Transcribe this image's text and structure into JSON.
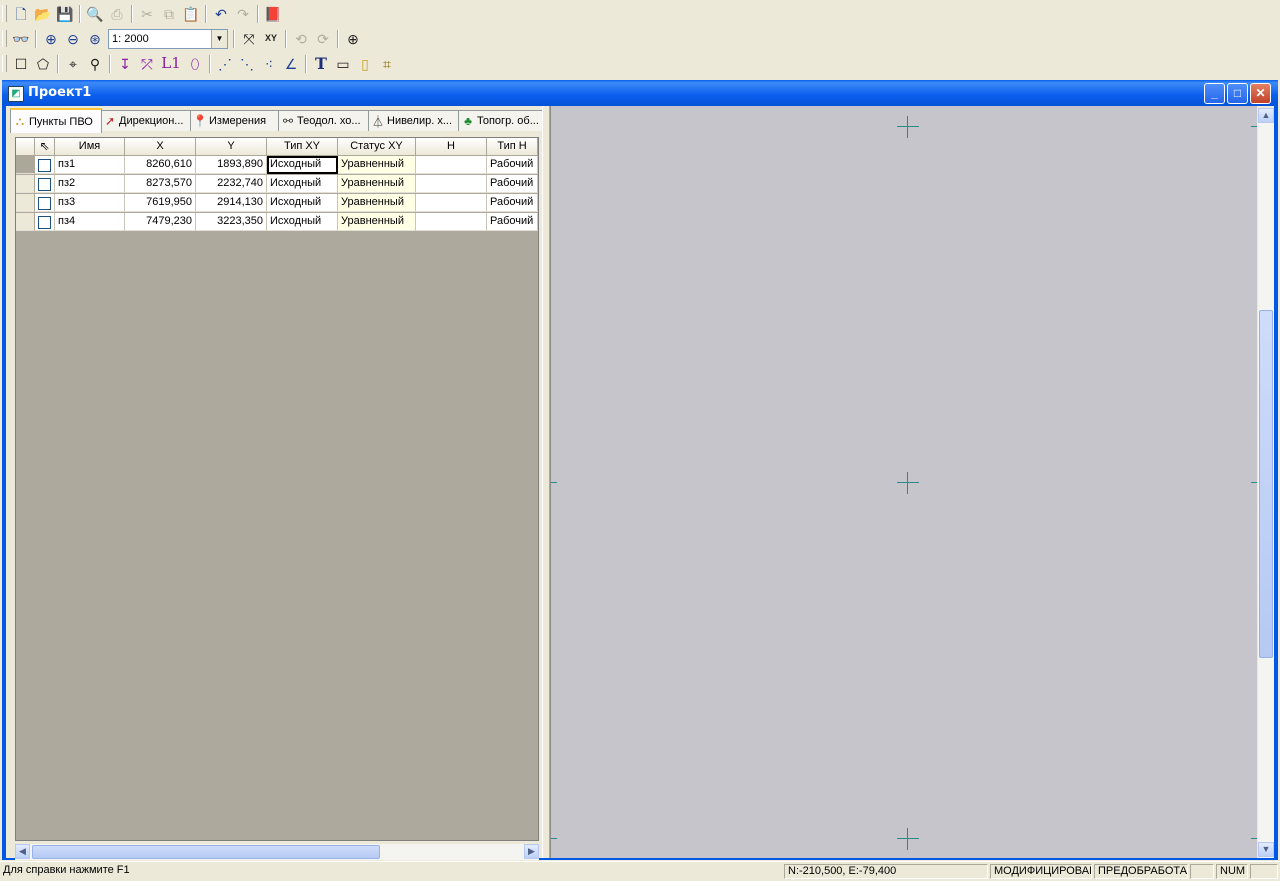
{
  "toolbar": {
    "scale_value": "1: 2000",
    "row1": [
      "new-file",
      "open-folder",
      "save",
      "print-preview",
      "print",
      "cut",
      "copy",
      "paste",
      "undo",
      "redo",
      "help-book"
    ],
    "row2": [
      "glasses",
      "zoom-in",
      "zoom-out",
      "zoom-fit",
      "scale-combo",
      "fit-extent",
      "xy-coords",
      "pan-prev",
      "pan-next",
      "target"
    ],
    "row3_text_tool_label": "T",
    "row3_lines_label": "L1"
  },
  "window": {
    "title": "Проект1"
  },
  "tabs": [
    {
      "label": "Пункты ПВО",
      "icon": "survey-points-icon",
      "active": true
    },
    {
      "label": "Дирекцион...",
      "icon": "direction-icon",
      "active": false
    },
    {
      "label": "Измерения",
      "icon": "measure-icon",
      "active": false
    },
    {
      "label": "Теодол. хо...",
      "icon": "theodolite-icon",
      "active": false
    },
    {
      "label": "Нивелир. х...",
      "icon": "level-icon",
      "active": false
    },
    {
      "label": "Топогр. об...",
      "icon": "tree-icon",
      "active": false
    }
  ],
  "grid": {
    "columns": [
      "Имя",
      "X",
      "Y",
      "Тип  XY",
      "Статус XY",
      "H",
      "Тип H"
    ],
    "rows": [
      {
        "name": "пз1",
        "x": "8260,610",
        "y": "1893,890",
        "type_xy": "Исходный",
        "status_xy": "Уравненный",
        "h": "",
        "type_h": "Рабочий"
      },
      {
        "name": "пз2",
        "x": "8273,570",
        "y": "2232,740",
        "type_xy": "Исходный",
        "status_xy": "Уравненный",
        "h": "",
        "type_h": "Рабочий"
      },
      {
        "name": "пз3",
        "x": "7619,950",
        "y": "2914,130",
        "type_xy": "Исходный",
        "status_xy": "Уравненный",
        "h": "",
        "type_h": "Рабочий"
      },
      {
        "name": "пз4",
        "x": "7479,230",
        "y": "3223,350",
        "type_xy": "Исходный",
        "status_xy": "Уравненный",
        "h": "",
        "type_h": "Рабочий"
      }
    ]
  },
  "status": {
    "help": "Для справки  нажмите  F1",
    "coords": "N:-210,500, E:-79,400",
    "modified": "МОДИФИЦИРОВАН",
    "preprocessed": "ПРЕДОБРАБОТАН",
    "num": "NUM"
  },
  "colors": {
    "title_blue": "#0a5ded",
    "canvas_bg": "#c6c5cb",
    "cross_color": "#2a8a8a",
    "grid_bg": "#ada99d"
  }
}
